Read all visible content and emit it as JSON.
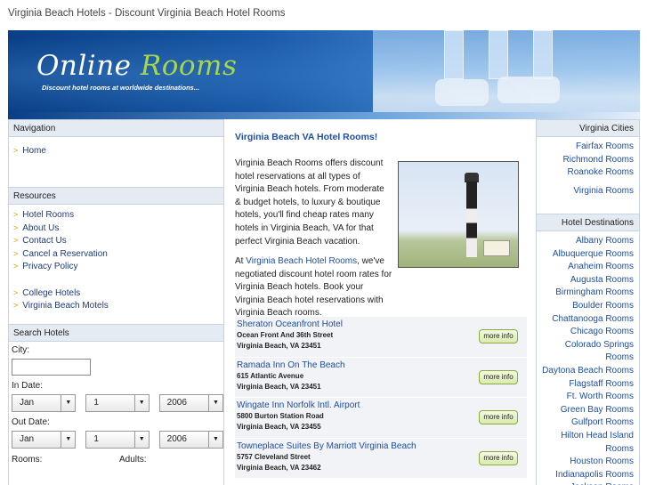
{
  "page_title": "Virginia Beach Hotels - Discount Virginia Beach Hotel Rooms",
  "banner": {
    "logo_part1": "Online",
    "logo_part2": "Rooms",
    "tagline": "Discount hotel rooms at worldwide destinations..."
  },
  "navigation": {
    "heading": "Navigation",
    "items": [
      "Home"
    ]
  },
  "resources": {
    "heading": "Resources",
    "items": [
      "Hotel Rooms",
      "About Us",
      "Contact Us",
      "Cancel a Reservation",
      "Privacy Policy"
    ],
    "items2": [
      "College Hotels",
      "Virginia Beach Motels"
    ]
  },
  "search": {
    "heading": "Search Hotels",
    "city_label": "City:",
    "city_value": "",
    "in_date_label": "In Date:",
    "out_date_label": "Out Date:",
    "in_month": "Jan",
    "in_day": "1",
    "in_year": "2006",
    "out_month": "Jan",
    "out_day": "1",
    "out_year": "2006",
    "rooms_label": "Rooms:",
    "adults_label": "Adults:"
  },
  "main": {
    "title": "Virginia Beach VA Hotel Rooms!",
    "intro": "Virginia Beach Rooms offers discount hotel reservations at all types of Virginia Beach hotels. From moderate & budget hotels, to luxury & boutique hotels, you'll find cheap rates many hotels in Virginia Beach, VA for that perfect Virginia Beach vacation.",
    "about_prefix": "At ",
    "about_link": "Virginia Beach Hotel Rooms",
    "about_suffix": ", we've negotiated discount hotel room rates for Virginia Beach hotels. Book your Virginia Beach hotel reservations with Virginia Beach rooms.",
    "more_label": "more info",
    "hotels": [
      {
        "name": "Sheraton Oceanfront Hotel",
        "street": "Ocean Front And 36th Street",
        "city": "Virginia Beach, VA 23451"
      },
      {
        "name": "Ramada Inn On The Beach",
        "street": "615 Atlantic Avenue",
        "city": "Virginia Beach, VA 23451"
      },
      {
        "name": "Wingate Inn Norfolk Intl. Airport",
        "street": "5800 Burton Station Road",
        "city": "Virginia Beach, VA 23455"
      },
      {
        "name": "Towneplace Suites By Marriott Virginia Beach",
        "street": "5757 Cleveland Street",
        "city": "Virginia Beach, VA 23462"
      }
    ]
  },
  "virginia_cities": {
    "heading": "Virginia Cities",
    "items": [
      "Fairfax Rooms",
      "Richmond Rooms",
      "Roanoke Rooms",
      "Virginia Rooms"
    ]
  },
  "hotel_destinations": {
    "heading": "Hotel Destinations",
    "items": [
      "Albany Rooms",
      "Albuquerque Rooms",
      "Anaheim Rooms",
      "Augusta Rooms",
      "Birmingham Rooms",
      "Boulder Rooms",
      "Chattanooga Rooms",
      "Chicago Rooms",
      "Colorado Springs Rooms",
      "Daytona Beach Rooms",
      "Flagstaff Rooms",
      "Ft. Worth Rooms",
      "Green Bay Rooms",
      "Gulfport Rooms",
      "Hilton Head Island Rooms",
      "Houston Rooms",
      "Indianapolis Rooms",
      "Jackson Rooms"
    ]
  }
}
